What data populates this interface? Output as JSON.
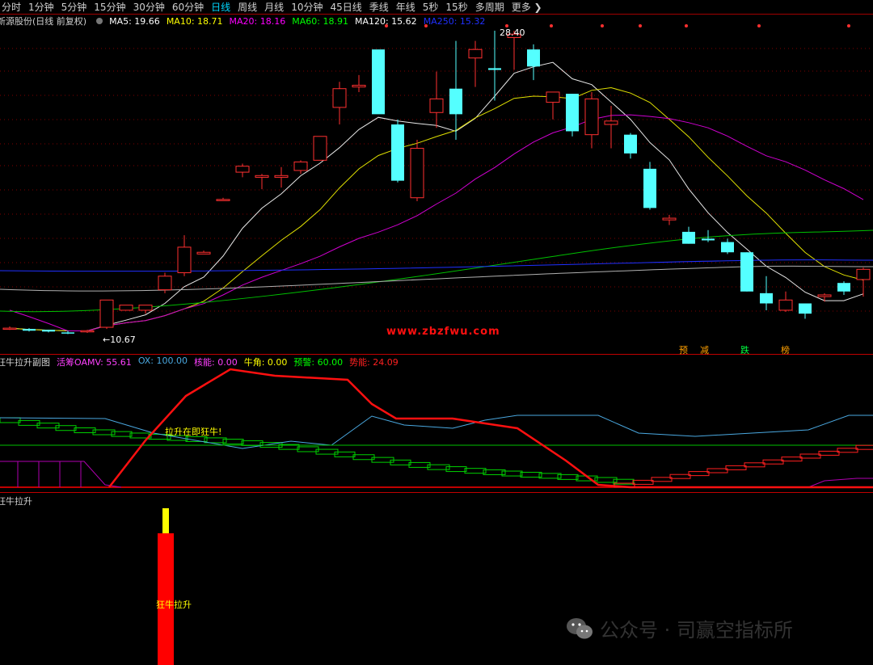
{
  "toolbar": {
    "items": [
      "分时",
      "1分钟",
      "5分钟",
      "15分钟",
      "30分钟",
      "60分钟",
      "日线",
      "周线",
      "月线",
      "10分钟",
      "45日线",
      "季线",
      "年线",
      "5秒",
      "15秒",
      "多周期",
      "更多"
    ],
    "active_index": 6,
    "more_arrow": "❯"
  },
  "main_panel": {
    "title": "新源股份(日线 前复权)",
    "ma": [
      {
        "label": "MA5: 19.66",
        "color": "#ffffff"
      },
      {
        "label": "MA10: 18.71",
        "color": "#ffff00"
      },
      {
        "label": "MA20: 18.16",
        "color": "#ff00ff"
      },
      {
        "label": "MA60: 18.91",
        "color": "#00ff00"
      },
      {
        "label": "MA120: 15.62",
        "color": "#ffffff"
      },
      {
        "label": "MA250: 15.32",
        "color": "#2030ff"
      }
    ],
    "high_label": "28.40",
    "low_label": "10.67",
    "watermark": "www.zbzfwu.com",
    "signals": [
      {
        "text": "预",
        "color": "#ffa000"
      },
      {
        "text": "减",
        "color": "#ffa000"
      },
      {
        "text": "跌",
        "color": "#00ff40"
      },
      {
        "text": "榜",
        "color": "#ffa000"
      }
    ]
  },
  "sub_panel": {
    "title": "狂牛拉升副图",
    "values": [
      {
        "label": "活筹OAMV: 55.61",
        "color": "#ff40ff"
      },
      {
        "label": "OX: 100.00",
        "color": "#4aa8e0"
      },
      {
        "label": "核能: 0.00",
        "color": "#ff40ff"
      },
      {
        "label": "牛角: 0.00",
        "color": "#ffff00"
      },
      {
        "label": "预警: 60.00",
        "color": "#00ff00"
      },
      {
        "label": "势能: 24.09",
        "color": "#ff2020"
      }
    ],
    "annotation": "拉升在即狂牛!"
  },
  "bottom_panel": {
    "title": "狂牛拉升",
    "bar_label": "狂牛拉升"
  },
  "footer": {
    "wechat_label": "公众号 · 司赢空指标所"
  },
  "colors": {
    "up": "#ff3030",
    "down": "#54ffff",
    "grid": "#800000"
  },
  "candles": [
    [
      10.95,
      11.05,
      10.85,
      10.95
    ],
    [
      10.9,
      10.95,
      10.75,
      10.8
    ],
    [
      10.85,
      10.85,
      10.7,
      10.75
    ],
    [
      10.7,
      10.8,
      10.6,
      10.65
    ],
    [
      10.75,
      10.85,
      10.67,
      10.8
    ],
    [
      11.0,
      12.6,
      10.9,
      12.6
    ],
    [
      12.0,
      12.3,
      12.0,
      12.3
    ],
    [
      12.0,
      12.3,
      11.8,
      12.3
    ],
    [
      13.2,
      14.2,
      13.0,
      14.0
    ],
    [
      14.2,
      16.4,
      14.0,
      15.7
    ],
    [
      15.3,
      15.5,
      15.3,
      15.4
    ],
    [
      18.5,
      18.6,
      18.5,
      18.5
    ],
    [
      20.1,
      20.6,
      19.8,
      20.45
    ],
    [
      19.8,
      20.0,
      19.1,
      19.9
    ],
    [
      19.8,
      20.4,
      19.2,
      19.9
    ],
    [
      20.2,
      20.8,
      20.0,
      20.7
    ],
    [
      20.8,
      22.2,
      20.8,
      22.2
    ],
    [
      23.9,
      25.4,
      22.9,
      25.0
    ],
    [
      25.1,
      25.8,
      24.8,
      25.2
    ],
    [
      27.3,
      26.4,
      23.6,
      23.5
    ],
    [
      22.9,
      23.2,
      19.5,
      19.6
    ],
    [
      18.6,
      22.0,
      18.4,
      21.5
    ],
    [
      23.6,
      26.0,
      22.7,
      24.4
    ],
    [
      25.0,
      27.8,
      22.0,
      23.5
    ],
    [
      26.8,
      27.8,
      25.1,
      27.3
    ],
    [
      26.2,
      28.4,
      24.3,
      26.1
    ],
    [
      28.0,
      28.4,
      26.1,
      28.2
    ],
    [
      27.3,
      27.6,
      25.5,
      26.3
    ],
    [
      24.2,
      24.7,
      23.2,
      24.8
    ],
    [
      24.7,
      24.7,
      22.2,
      22.5
    ],
    [
      22.3,
      24.8,
      21.5,
      24.4
    ],
    [
      22.9,
      24.0,
      21.5,
      23.1
    ],
    [
      22.3,
      22.4,
      20.9,
      21.2
    ],
    [
      20.3,
      20.7,
      17.9,
      18.0
    ],
    [
      17.3,
      17.6,
      17.0,
      17.4
    ],
    [
      16.6,
      16.9,
      15.9,
      15.9
    ],
    [
      16.2,
      16.7,
      16.0,
      16.1
    ],
    [
      16.0,
      16.2,
      15.3,
      15.4
    ],
    [
      15.4,
      15.4,
      13.1,
      13.1
    ],
    [
      13.0,
      14.0,
      12.0,
      12.4
    ],
    [
      12.0,
      13.1,
      11.9,
      12.6
    ],
    [
      12.4,
      12.4,
      11.5,
      11.8
    ],
    [
      12.8,
      13.0,
      12.5,
      12.9
    ],
    [
      13.6,
      13.7,
      12.9,
      13.1
    ],
    [
      13.8,
      14.5,
      12.8,
      14.4
    ]
  ]
}
